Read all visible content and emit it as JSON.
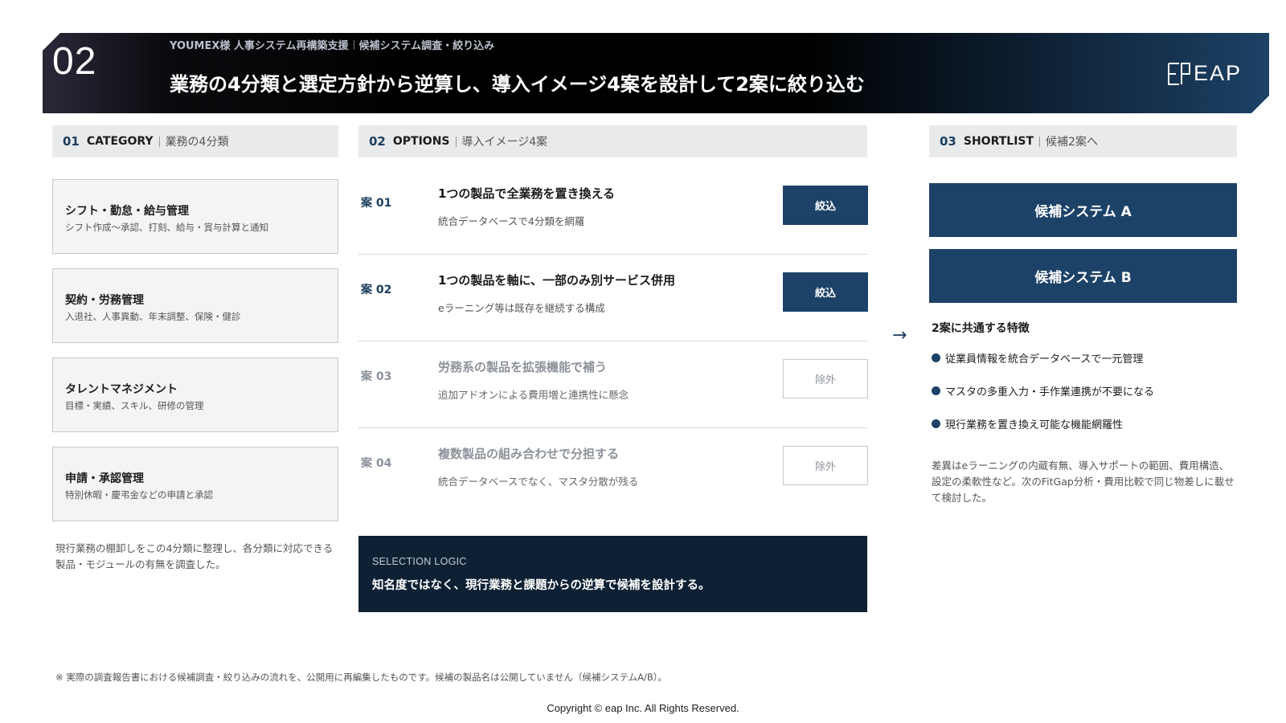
{
  "header": {
    "number": "02",
    "subtitle_left": "YOUMEX様 人事システム再構築支援",
    "subtitle_right": "候補システム調査・絞り込み",
    "title": "業務の4分類と選定方針から逆算し、導入イメージ4案を設計して2案に絞り込む",
    "brand": "EAP"
  },
  "category": {
    "num": "01",
    "label": "CATEGORY",
    "sub": "業務の4分類",
    "items": [
      {
        "title": "シフト・勤怠・給与管理",
        "desc": "シフト作成〜承認、打刻、給与・賞与計算と通知"
      },
      {
        "title": "契約・労務管理",
        "desc": "入退社、人事異動、年末調整、保険・健診"
      },
      {
        "title": "タレントマネジメント",
        "desc": "目標・実績、スキル、研修の管理"
      },
      {
        "title": "申請・承認管理",
        "desc": "特別休暇・慶弔金などの申請と承認"
      }
    ],
    "note": "現行業務の棚卸しをこの4分類に整理し、各分類に対応できる製品・モジュールの有無を調査した。"
  },
  "options": {
    "num": "02",
    "label": "OPTIONS",
    "sub": "導入イメージ4案",
    "items": [
      {
        "label": "案 01",
        "title": "1つの製品で全業務を置き換える",
        "desc": "統合データベースで4分類を網羅",
        "status": "絞込"
      },
      {
        "label": "案 02",
        "title": "1つの製品を軸に、一部のみ別サービス併用",
        "desc": "eラーニング等は既存を継続する構成",
        "status": "絞込"
      },
      {
        "label": "案 03",
        "title": "労務系の製品を拡張機能で補う",
        "desc": "追加アドオンによる費用増と連携性に懸念",
        "status": "除外"
      },
      {
        "label": "案 04",
        "title": "複数製品の組み合わせで分担する",
        "desc": "統合データベースでなく、マスタ分散が残る",
        "status": "除外"
      }
    ],
    "logic_label": "SELECTION LOGIC",
    "logic_text": "知名度ではなく、現行業務と課題からの逆算で候補を設計する。"
  },
  "arrow": "→",
  "shortlist": {
    "num": "03",
    "label": "SHORTLIST",
    "sub": "候補2案へ",
    "candidates": [
      "候補システム A",
      "候補システム B"
    ],
    "common_title": "2案に共通する特徴",
    "features": [
      "従業員情報を統合データベースで一元管理",
      "マスタの多重入力・手作業連携が不要になる",
      "現行業務を置き換え可能な機能網羅性"
    ],
    "diff_note": "差異はeラーニングの内蔵有無、導入サポートの範囲、費用構造、設定の柔軟性など。次のFitGap分析・費用比較で同じ物差しに載せて検討した。"
  },
  "footer": {
    "note": "※ 実際の調査報告書における候補調査・絞り込みの流れを、公開用に再編集したものです。候補の製品名は公開していません（候補システムA/B）。",
    "copyright": "Copyright © eap Inc. All Rights Reserved."
  },
  "colors": {
    "navy": "#1d4267",
    "dark_navy": "#0e2134",
    "section_bg": "#e9eaec",
    "card_bg": "#f3f4f5"
  },
  "icons": {
    "arrow": "right-arrow-icon",
    "bullet": "bullet-dot-icon",
    "brand": "eap-logo-icon"
  }
}
